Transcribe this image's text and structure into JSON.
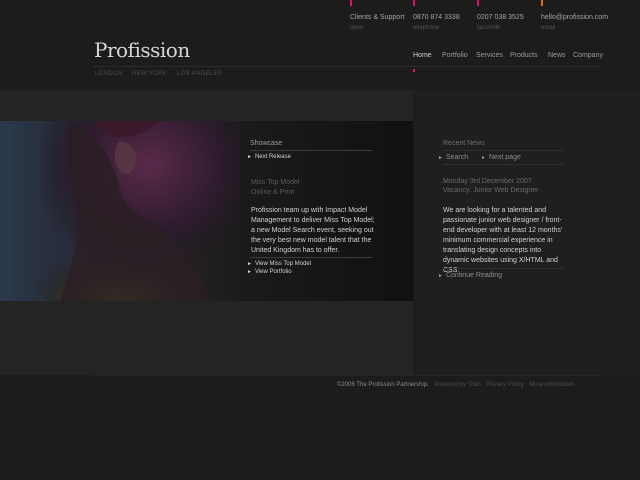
{
  "header": {
    "logo": "Profission",
    "contacts": [
      {
        "value": "Clients & Support",
        "label": "open",
        "color": "#d8146c"
      },
      {
        "value": "0870 874 3338",
        "label": "telephone",
        "color": "#d8146c"
      },
      {
        "value": "0207 038 3525",
        "label": "facsimile",
        "color": "#d8146c"
      },
      {
        "value": "hello@profission.com",
        "label": "email",
        "color": "#e06a1a"
      }
    ],
    "nav": [
      "Home",
      "Portfolio",
      "Services",
      "Products",
      "News",
      "Company"
    ],
    "active_nav": "Home",
    "cities": [
      "LONDON",
      "NEW YORK",
      "LOS ANGELES"
    ]
  },
  "showcase": {
    "heading": "Showcase",
    "next_link": "Next Release",
    "title": "Miss Top Model",
    "subtitle": "Online & Print",
    "body": "Profission team up with Impact Model Management to deliver Miss Top Model; a new Model Search event, seeking out the very best new model talent that the United Kingdom has to offer.",
    "links": [
      "View Miss Top Model",
      "View Portfolio"
    ]
  },
  "news": {
    "heading": "Recent News",
    "search_link": "Search",
    "next_link": "Next page",
    "date": "Monday 3rd December 2007",
    "title": "Vacancy: Junior Web Designer",
    "body": "We are looking for a talented and passionate junior web designer / front-end developer with at least 12 months' minimum commercial experience in translating design concepts into dynamic websites using X/HTML and CSS.",
    "continue_link": "Continue Reading"
  },
  "footer": {
    "copyright": "©2006 The Profission Partnership.",
    "links": [
      "Powered by Titan",
      "Privacy Policy",
      "More information"
    ]
  },
  "colors": {
    "accent": "#d8146c",
    "accent_secondary": "#e06a1a",
    "background": "#1b1c1b"
  }
}
